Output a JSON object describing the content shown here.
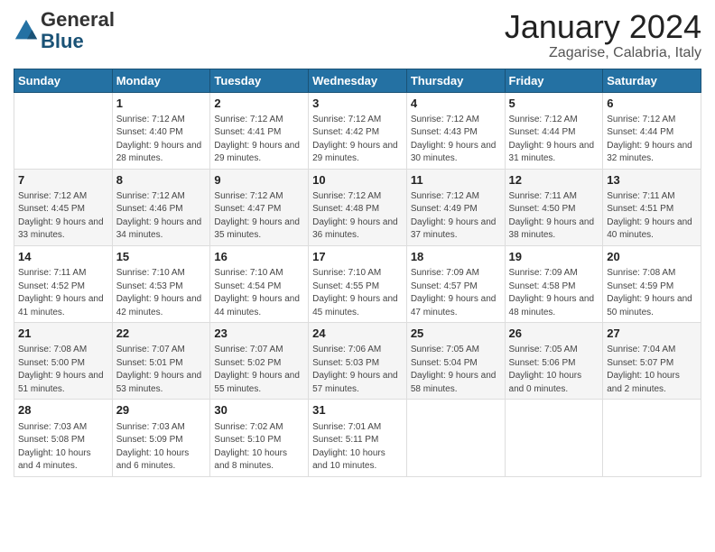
{
  "header": {
    "logo": {
      "line1": "General",
      "line2": "Blue"
    },
    "title": "January 2024",
    "subtitle": "Zagarise, Calabria, Italy"
  },
  "calendar": {
    "days_of_week": [
      "Sunday",
      "Monday",
      "Tuesday",
      "Wednesday",
      "Thursday",
      "Friday",
      "Saturday"
    ],
    "weeks": [
      [
        {
          "day": "",
          "sunrise": "",
          "sunset": "",
          "daylight": ""
        },
        {
          "day": "1",
          "sunrise": "Sunrise: 7:12 AM",
          "sunset": "Sunset: 4:40 PM",
          "daylight": "Daylight: 9 hours and 28 minutes."
        },
        {
          "day": "2",
          "sunrise": "Sunrise: 7:12 AM",
          "sunset": "Sunset: 4:41 PM",
          "daylight": "Daylight: 9 hours and 29 minutes."
        },
        {
          "day": "3",
          "sunrise": "Sunrise: 7:12 AM",
          "sunset": "Sunset: 4:42 PM",
          "daylight": "Daylight: 9 hours and 29 minutes."
        },
        {
          "day": "4",
          "sunrise": "Sunrise: 7:12 AM",
          "sunset": "Sunset: 4:43 PM",
          "daylight": "Daylight: 9 hours and 30 minutes."
        },
        {
          "day": "5",
          "sunrise": "Sunrise: 7:12 AM",
          "sunset": "Sunset: 4:44 PM",
          "daylight": "Daylight: 9 hours and 31 minutes."
        },
        {
          "day": "6",
          "sunrise": "Sunrise: 7:12 AM",
          "sunset": "Sunset: 4:44 PM",
          "daylight": "Daylight: 9 hours and 32 minutes."
        }
      ],
      [
        {
          "day": "7",
          "sunrise": "Sunrise: 7:12 AM",
          "sunset": "Sunset: 4:45 PM",
          "daylight": "Daylight: 9 hours and 33 minutes."
        },
        {
          "day": "8",
          "sunrise": "Sunrise: 7:12 AM",
          "sunset": "Sunset: 4:46 PM",
          "daylight": "Daylight: 9 hours and 34 minutes."
        },
        {
          "day": "9",
          "sunrise": "Sunrise: 7:12 AM",
          "sunset": "Sunset: 4:47 PM",
          "daylight": "Daylight: 9 hours and 35 minutes."
        },
        {
          "day": "10",
          "sunrise": "Sunrise: 7:12 AM",
          "sunset": "Sunset: 4:48 PM",
          "daylight": "Daylight: 9 hours and 36 minutes."
        },
        {
          "day": "11",
          "sunrise": "Sunrise: 7:12 AM",
          "sunset": "Sunset: 4:49 PM",
          "daylight": "Daylight: 9 hours and 37 minutes."
        },
        {
          "day": "12",
          "sunrise": "Sunrise: 7:11 AM",
          "sunset": "Sunset: 4:50 PM",
          "daylight": "Daylight: 9 hours and 38 minutes."
        },
        {
          "day": "13",
          "sunrise": "Sunrise: 7:11 AM",
          "sunset": "Sunset: 4:51 PM",
          "daylight": "Daylight: 9 hours and 40 minutes."
        }
      ],
      [
        {
          "day": "14",
          "sunrise": "Sunrise: 7:11 AM",
          "sunset": "Sunset: 4:52 PM",
          "daylight": "Daylight: 9 hours and 41 minutes."
        },
        {
          "day": "15",
          "sunrise": "Sunrise: 7:10 AM",
          "sunset": "Sunset: 4:53 PM",
          "daylight": "Daylight: 9 hours and 42 minutes."
        },
        {
          "day": "16",
          "sunrise": "Sunrise: 7:10 AM",
          "sunset": "Sunset: 4:54 PM",
          "daylight": "Daylight: 9 hours and 44 minutes."
        },
        {
          "day": "17",
          "sunrise": "Sunrise: 7:10 AM",
          "sunset": "Sunset: 4:55 PM",
          "daylight": "Daylight: 9 hours and 45 minutes."
        },
        {
          "day": "18",
          "sunrise": "Sunrise: 7:09 AM",
          "sunset": "Sunset: 4:57 PM",
          "daylight": "Daylight: 9 hours and 47 minutes."
        },
        {
          "day": "19",
          "sunrise": "Sunrise: 7:09 AM",
          "sunset": "Sunset: 4:58 PM",
          "daylight": "Daylight: 9 hours and 48 minutes."
        },
        {
          "day": "20",
          "sunrise": "Sunrise: 7:08 AM",
          "sunset": "Sunset: 4:59 PM",
          "daylight": "Daylight: 9 hours and 50 minutes."
        }
      ],
      [
        {
          "day": "21",
          "sunrise": "Sunrise: 7:08 AM",
          "sunset": "Sunset: 5:00 PM",
          "daylight": "Daylight: 9 hours and 51 minutes."
        },
        {
          "day": "22",
          "sunrise": "Sunrise: 7:07 AM",
          "sunset": "Sunset: 5:01 PM",
          "daylight": "Daylight: 9 hours and 53 minutes."
        },
        {
          "day": "23",
          "sunrise": "Sunrise: 7:07 AM",
          "sunset": "Sunset: 5:02 PM",
          "daylight": "Daylight: 9 hours and 55 minutes."
        },
        {
          "day": "24",
          "sunrise": "Sunrise: 7:06 AM",
          "sunset": "Sunset: 5:03 PM",
          "daylight": "Daylight: 9 hours and 57 minutes."
        },
        {
          "day": "25",
          "sunrise": "Sunrise: 7:05 AM",
          "sunset": "Sunset: 5:04 PM",
          "daylight": "Daylight: 9 hours and 58 minutes."
        },
        {
          "day": "26",
          "sunrise": "Sunrise: 7:05 AM",
          "sunset": "Sunset: 5:06 PM",
          "daylight": "Daylight: 10 hours and 0 minutes."
        },
        {
          "day": "27",
          "sunrise": "Sunrise: 7:04 AM",
          "sunset": "Sunset: 5:07 PM",
          "daylight": "Daylight: 10 hours and 2 minutes."
        }
      ],
      [
        {
          "day": "28",
          "sunrise": "Sunrise: 7:03 AM",
          "sunset": "Sunset: 5:08 PM",
          "daylight": "Daylight: 10 hours and 4 minutes."
        },
        {
          "day": "29",
          "sunrise": "Sunrise: 7:03 AM",
          "sunset": "Sunset: 5:09 PM",
          "daylight": "Daylight: 10 hours and 6 minutes."
        },
        {
          "day": "30",
          "sunrise": "Sunrise: 7:02 AM",
          "sunset": "Sunset: 5:10 PM",
          "daylight": "Daylight: 10 hours and 8 minutes."
        },
        {
          "day": "31",
          "sunrise": "Sunrise: 7:01 AM",
          "sunset": "Sunset: 5:11 PM",
          "daylight": "Daylight: 10 hours and 10 minutes."
        },
        {
          "day": "",
          "sunrise": "",
          "sunset": "",
          "daylight": ""
        },
        {
          "day": "",
          "sunrise": "",
          "sunset": "",
          "daylight": ""
        },
        {
          "day": "",
          "sunrise": "",
          "sunset": "",
          "daylight": ""
        }
      ]
    ]
  }
}
